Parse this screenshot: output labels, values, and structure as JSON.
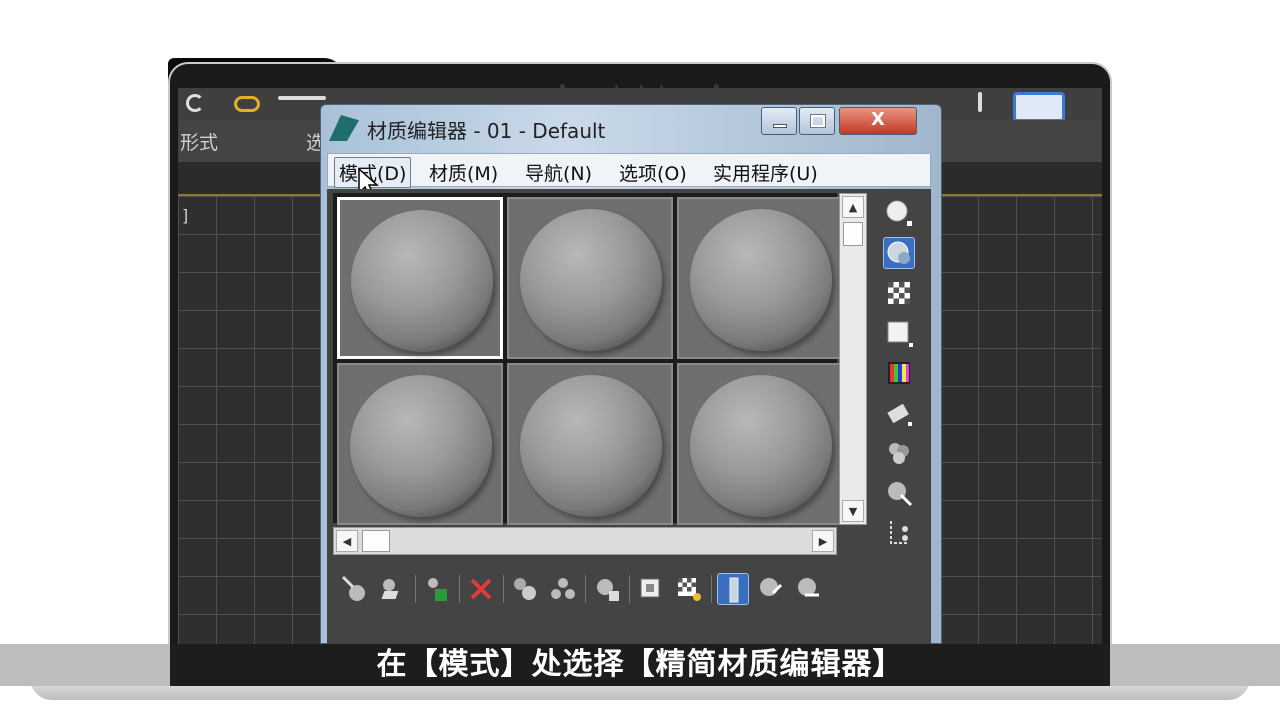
{
  "app": {
    "window_title": "材质编辑器 - 01 - Default",
    "ribbon_left_label": "形式",
    "ribbon_mid_label": "选",
    "viewport_bracket": "]"
  },
  "menubar": {
    "items": [
      {
        "label": "模式(D)",
        "active": true
      },
      {
        "label": "材质(M)",
        "active": false
      },
      {
        "label": "导航(N)",
        "active": false
      },
      {
        "label": "选项(O)",
        "active": false
      },
      {
        "label": "实用程序(U)",
        "active": false
      }
    ]
  },
  "window_controls": {
    "close_glyph": "X"
  },
  "sample_slots": {
    "rows": 2,
    "cols": 3,
    "selected_index": 0
  },
  "side_toolbar": {
    "icons": [
      "sample-type-sphere-icon",
      "backlight-icon",
      "background-checker-icon",
      "sample-uv-tiling-icon",
      "video-color-check-icon",
      "make-preview-icon",
      "options-icon",
      "select-by-material-icon",
      "material-map-navigator-icon"
    ],
    "active_index": 1
  },
  "bottom_toolbar": {
    "icons": [
      "get-material-icon",
      "put-to-scene-icon",
      "assign-to-selection-icon",
      "reset-map-icon",
      "copy-material-icon",
      "make-unique-icon",
      "put-to-library-icon",
      "material-id-channel-icon",
      "show-shaded-material-icon",
      "show-end-result-icon",
      "go-to-parent-icon",
      "go-forward-sibling-icon"
    ],
    "active_index": 9
  },
  "colors": {
    "selection_blue": "#3a6fbf",
    "close_red": "#c13a22",
    "viewport_bg": "#2f2f2f"
  },
  "subtitle": {
    "text": "在【模式】处选择【精简材质编辑器】"
  }
}
